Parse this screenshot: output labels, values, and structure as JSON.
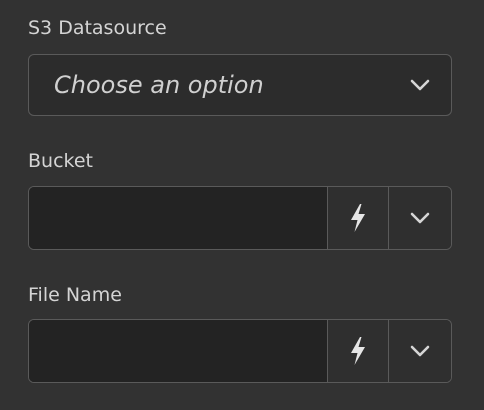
{
  "s3_datasource": {
    "label": "S3 Datasource",
    "placeholder": "Choose an option",
    "icon": "chevron-down-icon"
  },
  "bucket": {
    "label": "Bucket",
    "value": "",
    "dynamic_icon": "lightning-icon",
    "dropdown_icon": "chevron-down-icon"
  },
  "file_name": {
    "label": "File Name",
    "value": "",
    "dynamic_icon": "lightning-icon",
    "dropdown_icon": "chevron-down-icon"
  },
  "colors": {
    "background": "#323232",
    "field_bg": "#232323",
    "border": "#5a5a5a",
    "text": "#d4d4d4"
  }
}
